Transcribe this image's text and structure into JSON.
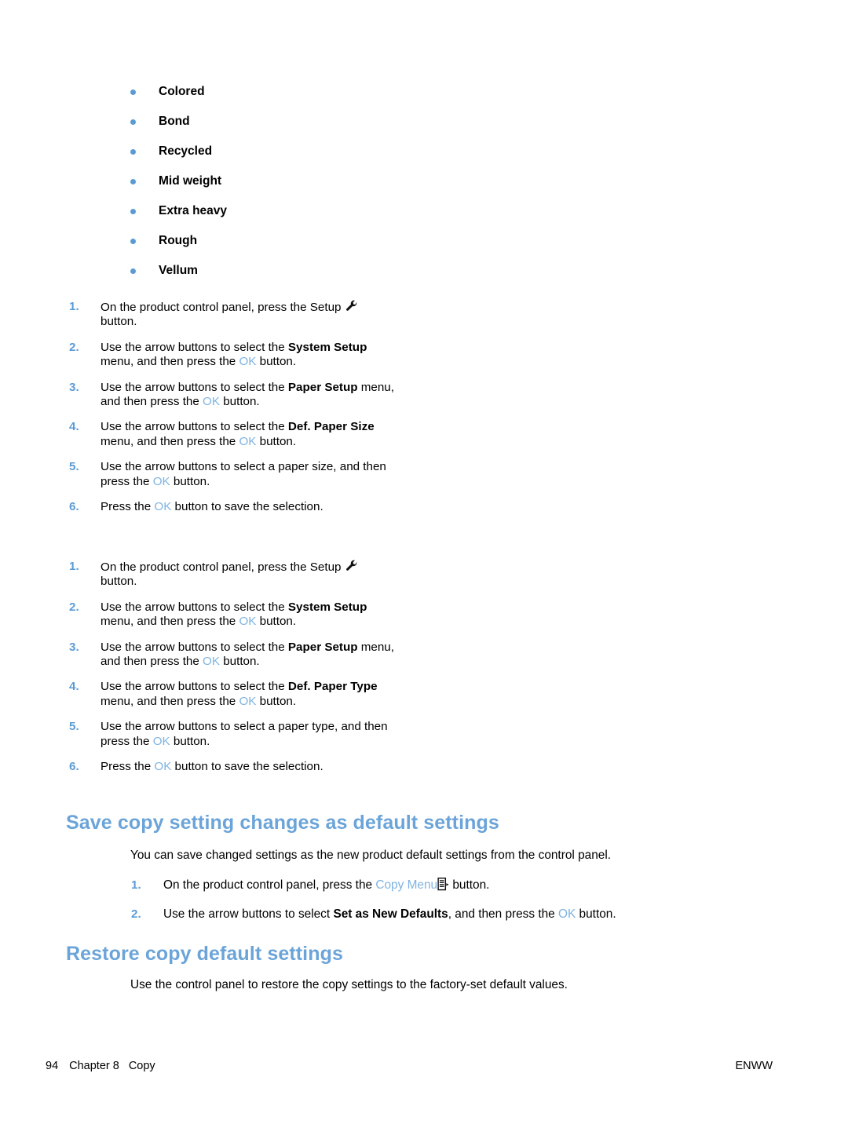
{
  "paper_types": {
    "items": [
      {
        "label": "Colored"
      },
      {
        "label": "Bond"
      },
      {
        "label": "Recycled"
      },
      {
        "label": "Mid weight"
      },
      {
        "label": "Extra heavy"
      },
      {
        "label": "Rough"
      },
      {
        "label": "Vellum"
      }
    ]
  },
  "procedure_paper_size": {
    "steps": [
      {
        "number": "1.",
        "prefix": "On the product control panel, press the Setup ",
        "icon": "wrench-icon",
        "suffix": " button."
      },
      {
        "number": "2.",
        "lead": "Use the arrow buttons to select the ",
        "menu": "System Setup",
        "mid": " menu, and then press the ",
        "ok": "OK",
        "tail": " button."
      },
      {
        "number": "3.",
        "lead": "Use the arrow buttons to select the ",
        "menu": "Paper Setup",
        "mid": " menu, and then press the ",
        "ok": "OK",
        "tail": " button."
      },
      {
        "number": "4.",
        "lead": "Use the arrow buttons to select the ",
        "menu": "Def. Paper Size",
        "mid": " menu, and then press the ",
        "ok": "OK",
        "tail": " button."
      },
      {
        "number": "5.",
        "lead": "Use the arrow buttons to select a paper size, and then press the ",
        "ok": "OK",
        "tail": " button."
      },
      {
        "number": "6.",
        "lead": "Press the ",
        "ok": "OK",
        "tail": " button to save the selection."
      }
    ]
  },
  "procedure_paper_type": {
    "steps": [
      {
        "number": "1.",
        "prefix": "On the product control panel, press the Setup ",
        "icon": "wrench-icon",
        "suffix": " button."
      },
      {
        "number": "2.",
        "lead": "Use the arrow buttons to select the ",
        "menu": "System Setup",
        "mid": " menu, and then press the ",
        "ok": "OK",
        "tail": " button."
      },
      {
        "number": "3.",
        "lead": "Use the arrow buttons to select the ",
        "menu": "Paper Setup",
        "mid": " menu, and then press the ",
        "ok": "OK",
        "tail": " button."
      },
      {
        "number": "4.",
        "lead": "Use the arrow buttons to select the ",
        "menu": "Def. Paper Type",
        "mid": " menu, and then press the ",
        "ok": "OK",
        "tail": " button."
      },
      {
        "number": "5.",
        "lead": "Use the arrow buttons to select a paper type, and then press the ",
        "ok": "OK",
        "tail": " button."
      },
      {
        "number": "6.",
        "lead": "Press the ",
        "ok": "OK",
        "tail": " button to save the selection."
      }
    ]
  },
  "section_save": {
    "heading": "Save copy setting changes as default settings",
    "intro": "You can save changed settings as the new product default settings from the control panel.",
    "steps": [
      {
        "number": "1.",
        "lead": "On the product control panel, press the ",
        "copy_menu": "Copy Menu",
        "icon": "copy-menu-icon",
        "tail": " button."
      },
      {
        "number": "2.",
        "lead": "Use the arrow buttons to select ",
        "menu": "Set as New Defaults",
        "mid": ", and then press the ",
        "ok": "OK",
        "tail": " button."
      }
    ]
  },
  "section_restore": {
    "heading": "Restore copy default settings",
    "intro": "Use the control panel to restore the copy settings to the factory-set default values."
  },
  "footer": {
    "page_number": "94",
    "chapter": "Chapter 8",
    "section": "Copy",
    "locale": "ENWW"
  },
  "colors": {
    "accent_blue": "#6ba4d8",
    "bullet_blue": "#5b9bd5",
    "ok_blue": "#7fb3e0"
  }
}
